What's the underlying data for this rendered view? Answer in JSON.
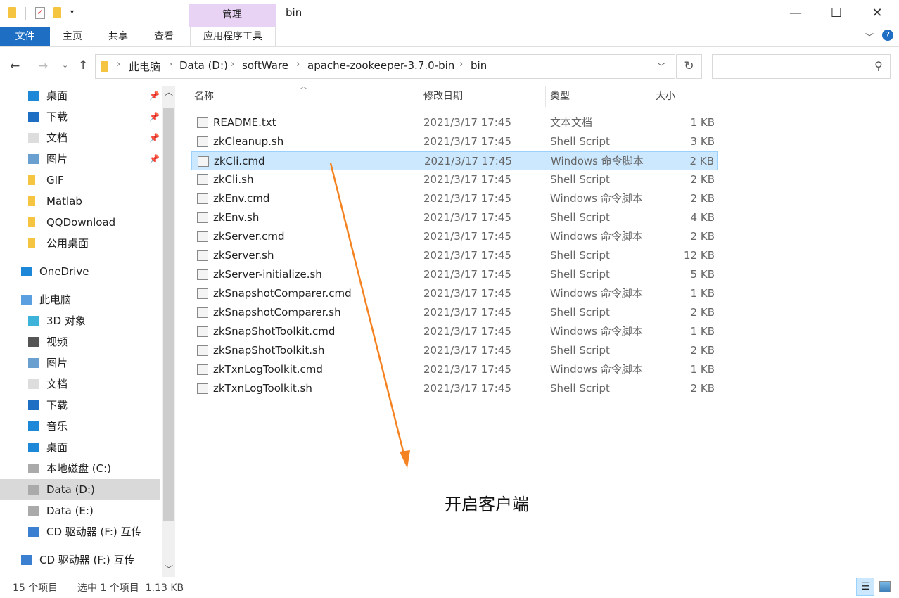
{
  "title_bar": {
    "title": "bin",
    "context_tab": "管理"
  },
  "ribbon": {
    "tabs": [
      "文件",
      "主页",
      "共享",
      "查看",
      "应用程序工具"
    ]
  },
  "address": {
    "crumbs": [
      "此电脑",
      "Data (D:)",
      "softWare",
      "apache-zookeeper-3.7.0-bin",
      "bin"
    ],
    "search_placeholder": ""
  },
  "nav": {
    "items": [
      {
        "label": "桌面",
        "icon": "desktop-icon",
        "pinned": true
      },
      {
        "label": "下载",
        "icon": "download-icon",
        "pinned": true
      },
      {
        "label": "文档",
        "icon": "document-icon",
        "pinned": true
      },
      {
        "label": "图片",
        "icon": "picture-icon",
        "pinned": true
      },
      {
        "label": "GIF",
        "icon": "folder-icon"
      },
      {
        "label": "Matlab",
        "icon": "folder-icon"
      },
      {
        "label": "QQDownload",
        "icon": "folder-icon"
      },
      {
        "label": "公用桌面",
        "icon": "folder-icon"
      },
      {
        "label": "OneDrive",
        "icon": "cloud-icon"
      },
      {
        "label": "此电脑",
        "icon": "computer-icon"
      },
      {
        "label": "3D 对象",
        "icon": "cube-icon"
      },
      {
        "label": "视频",
        "icon": "video-icon"
      },
      {
        "label": "图片",
        "icon": "picture-icon"
      },
      {
        "label": "文档",
        "icon": "document-icon"
      },
      {
        "label": "下载",
        "icon": "download-icon"
      },
      {
        "label": "音乐",
        "icon": "music-icon"
      },
      {
        "label": "桌面",
        "icon": "desktop-icon"
      },
      {
        "label": "本地磁盘 (C:)",
        "icon": "drive-icon"
      },
      {
        "label": "Data (D:)",
        "icon": "drive-icon",
        "selected": true
      },
      {
        "label": "Data (E:)",
        "icon": "drive-icon"
      },
      {
        "label": "CD 驱动器 (F:) 互传",
        "icon": "cd-icon"
      },
      {
        "label": "CD 驱动器 (F:) 互传",
        "icon": "cd-icon"
      }
    ]
  },
  "columns": {
    "name": "名称",
    "date": "修改日期",
    "type": "类型",
    "size": "大小"
  },
  "files": [
    {
      "name": "README.txt",
      "date": "2021/3/17 17:45",
      "type": "文本文档",
      "size": "1 KB"
    },
    {
      "name": "zkCleanup.sh",
      "date": "2021/3/17 17:45",
      "type": "Shell Script",
      "size": "3 KB"
    },
    {
      "name": "zkCli.cmd",
      "date": "2021/3/17 17:45",
      "type": "Windows 命令脚本",
      "size": "2 KB",
      "selected": true
    },
    {
      "name": "zkCli.sh",
      "date": "2021/3/17 17:45",
      "type": "Shell Script",
      "size": "2 KB"
    },
    {
      "name": "zkEnv.cmd",
      "date": "2021/3/17 17:45",
      "type": "Windows 命令脚本",
      "size": "2 KB"
    },
    {
      "name": "zkEnv.sh",
      "date": "2021/3/17 17:45",
      "type": "Shell Script",
      "size": "4 KB"
    },
    {
      "name": "zkServer.cmd",
      "date": "2021/3/17 17:45",
      "type": "Windows 命令脚本",
      "size": "2 KB"
    },
    {
      "name": "zkServer.sh",
      "date": "2021/3/17 17:45",
      "type": "Shell Script",
      "size": "12 KB"
    },
    {
      "name": "zkServer-initialize.sh",
      "date": "2021/3/17 17:45",
      "type": "Shell Script",
      "size": "5 KB"
    },
    {
      "name": "zkSnapshotComparer.cmd",
      "date": "2021/3/17 17:45",
      "type": "Windows 命令脚本",
      "size": "1 KB"
    },
    {
      "name": "zkSnapshotComparer.sh",
      "date": "2021/3/17 17:45",
      "type": "Shell Script",
      "size": "2 KB"
    },
    {
      "name": "zkSnapShotToolkit.cmd",
      "date": "2021/3/17 17:45",
      "type": "Windows 命令脚本",
      "size": "1 KB"
    },
    {
      "name": "zkSnapShotToolkit.sh",
      "date": "2021/3/17 17:45",
      "type": "Shell Script",
      "size": "2 KB"
    },
    {
      "name": "zkTxnLogToolkit.cmd",
      "date": "2021/3/17 17:45",
      "type": "Windows 命令脚本",
      "size": "1 KB"
    },
    {
      "name": "zkTxnLogToolkit.sh",
      "date": "2021/3/17 17:45",
      "type": "Shell Script",
      "size": "2 KB"
    }
  ],
  "annotation": {
    "text": "开启客户端",
    "color": "#f58220"
  },
  "status": {
    "count": "15 个项目",
    "selection": "选中 1 个项目  1.13 KB"
  },
  "colors": {
    "file_tab": "#1e6fc4",
    "context_tab": "#e8d3f5",
    "selection": "#cce8ff"
  }
}
